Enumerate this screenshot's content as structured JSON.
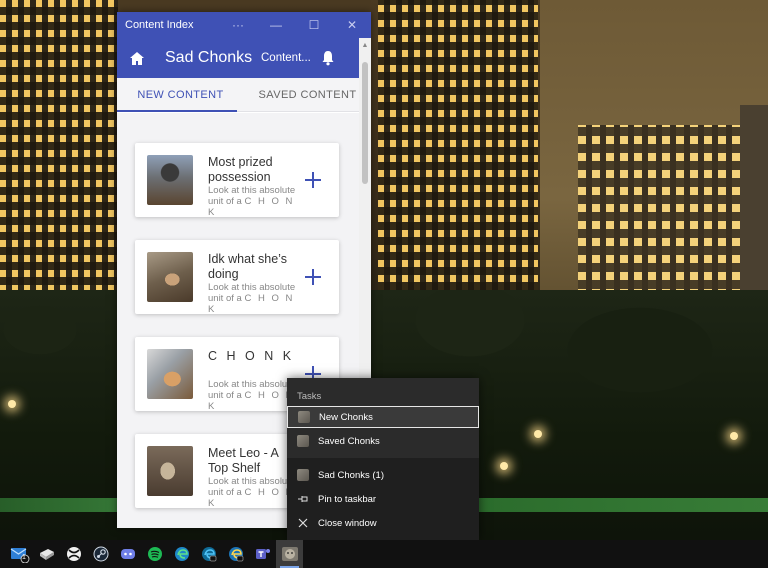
{
  "window": {
    "title": "Content Index",
    "more_label": "···",
    "minimize_label": "—",
    "maximize_label": "☐",
    "close_label": "✕"
  },
  "appbar": {
    "title": "Sad Chonks",
    "menu_label": "Content...",
    "home_icon": "home-icon",
    "bell_icon": "bell-icon"
  },
  "tabs": [
    {
      "label": "NEW CONTENT",
      "active": true
    },
    {
      "label": "SAVED CONTENT",
      "active": false
    }
  ],
  "cards": [
    {
      "title": "Most prized possession",
      "desc_prefix": "Look at this absolute unit of a",
      "desc_word": "C H O N K"
    },
    {
      "title": "Idk what she’s doing",
      "desc_prefix": "Look at this absolute unit of a",
      "desc_word": "C H O N K"
    },
    {
      "title": "C H O N K",
      "desc_prefix": "Look at this absolute unit of a",
      "desc_word": "C H O N K"
    },
    {
      "title": "Meet Leo - A Top Shelf",
      "desc_prefix": "Look at this absolute unit of a",
      "desc_word": "C H O N K"
    }
  ],
  "jumplist": {
    "header": "Tasks",
    "tasks": [
      {
        "label": "New Chonks",
        "selected": true
      },
      {
        "label": "Saved Chonks",
        "selected": false
      }
    ],
    "pinned": [
      {
        "label": "Sad Chonks (1)",
        "icon": "app-icon"
      },
      {
        "label": "Pin to taskbar",
        "icon": "pin-icon"
      },
      {
        "label": "Close window",
        "icon": "close-icon"
      }
    ]
  },
  "taskbar": {
    "mail_badge": "1",
    "apps": [
      "mail-icon",
      "file-explorer-icon",
      "xbox-icon",
      "steam-icon",
      "discord-icon",
      "spotify-icon",
      "edge-icon",
      "edge-dev-icon",
      "edge-canary-icon",
      "teams-icon",
      "sad-chonks-icon"
    ]
  },
  "colors": {
    "accent": "#3f51b5",
    "jumplist_bg": "#2b2b2b",
    "taskbar_bg": "#111111"
  }
}
